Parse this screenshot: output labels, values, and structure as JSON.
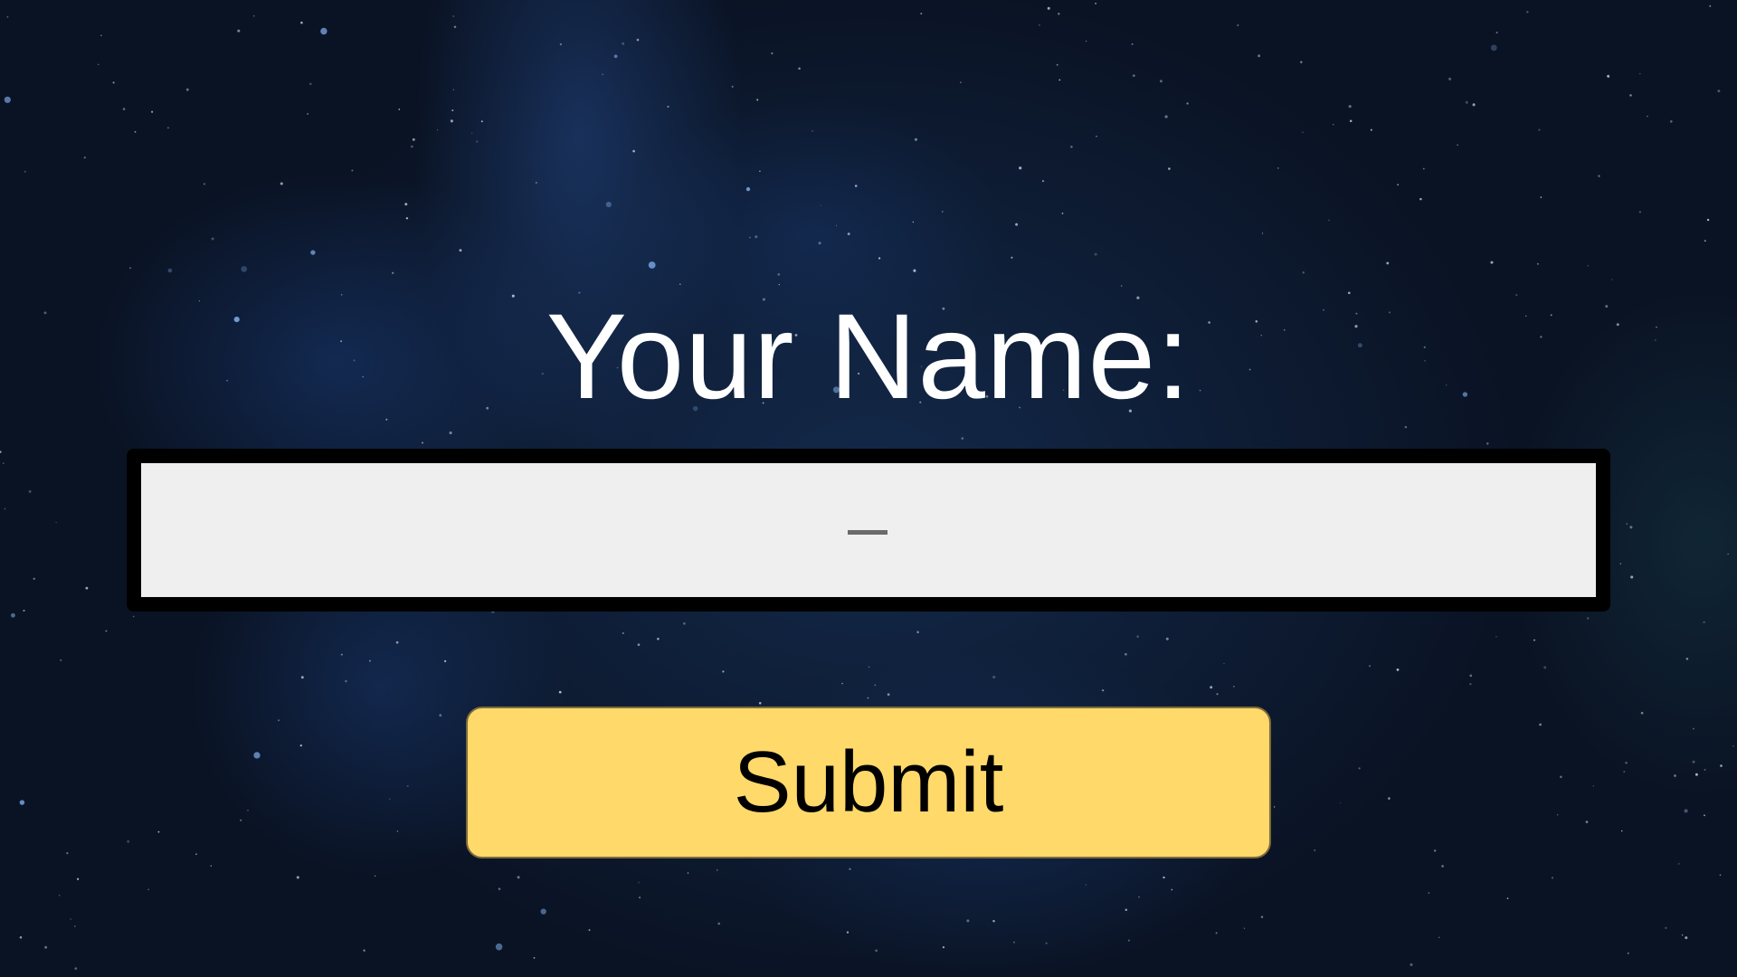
{
  "form": {
    "title": "Your Name:",
    "name_input": {
      "value": "",
      "placeholder": "",
      "caret_glyph": "_"
    },
    "submit_label": "Submit"
  },
  "colors": {
    "background": "#0b1220",
    "input_border": "#000000",
    "input_fill": "#efefef",
    "button_fill": "#ffd96a",
    "title_text": "#ffffff"
  }
}
